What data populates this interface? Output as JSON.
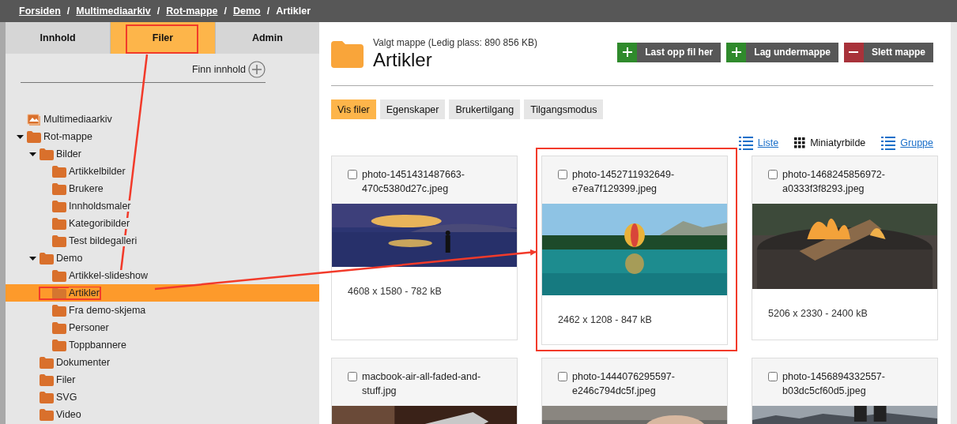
{
  "breadcrumbs": [
    {
      "label": "Forsiden",
      "kind": "link"
    },
    {
      "label": "/",
      "kind": "separator"
    },
    {
      "label": "Multimediaarkiv",
      "kind": "link"
    },
    {
      "label": "/",
      "kind": "separator"
    },
    {
      "label": "Rot-mappe",
      "kind": "link"
    },
    {
      "label": "/",
      "kind": "separator"
    },
    {
      "label": "Demo",
      "kind": "link"
    },
    {
      "label": "/",
      "kind": "separator"
    },
    {
      "label": "Artikler",
      "kind": "current"
    }
  ],
  "sidebar": {
    "tabs": [
      {
        "label": "Innhold",
        "selected": false
      },
      {
        "label": "Filer",
        "selected": true,
        "highlighted": true
      },
      {
        "label": "Admin",
        "selected": false
      }
    ],
    "find_label": "Finn innhold",
    "tree": [
      {
        "label": "Multimediaarkiv",
        "kind": "archive",
        "selected": false
      },
      {
        "label": "Rot-mappe",
        "kind": "folder",
        "selected": false,
        "expanded": true,
        "children": [
          {
            "label": "Bilder",
            "kind": "folder",
            "selected": false,
            "expanded": true,
            "children": [
              {
                "label": "Artikkelbilder",
                "kind": "folder",
                "selected": false
              },
              {
                "label": "Brukere",
                "kind": "folder",
                "selected": false
              },
              {
                "label": "Innholdsmaler",
                "kind": "folder",
                "selected": false
              },
              {
                "label": "Kategoribilder",
                "kind": "folder",
                "selected": false
              },
              {
                "label": "Test bildegalleri",
                "kind": "folder",
                "selected": false
              }
            ]
          },
          {
            "label": "Demo",
            "kind": "folder",
            "selected": false,
            "expanded": true,
            "children": [
              {
                "label": "Artikkel-slideshow",
                "kind": "folder",
                "selected": false
              },
              {
                "label": "Artikler",
                "kind": "folder",
                "selected": true,
                "highlighted": true
              },
              {
                "label": "Fra demo-skjema",
                "kind": "folder",
                "selected": false
              },
              {
                "label": "Personer",
                "kind": "folder",
                "selected": false
              },
              {
                "label": "Toppbannere",
                "kind": "folder",
                "selected": false
              }
            ]
          },
          {
            "label": "Dokumenter",
            "kind": "folder",
            "selected": false
          },
          {
            "label": "Filer",
            "kind": "folder",
            "selected": false
          },
          {
            "label": "SVG",
            "kind": "folder",
            "selected": false
          },
          {
            "label": "Video",
            "kind": "folder",
            "selected": false
          }
        ]
      }
    ]
  },
  "folder": {
    "caption": "Valgt mappe (Ledig plass: 890 856 KB)",
    "title": "Artikler",
    "actions": [
      {
        "label": "Last opp fil her",
        "kind": "add"
      },
      {
        "label": "Lag undermappe",
        "kind": "add"
      },
      {
        "label": "Slett mappe",
        "kind": "delete"
      }
    ],
    "tabs": [
      {
        "label": "Vis filer",
        "selected": true
      },
      {
        "label": "Egenskaper",
        "selected": false
      },
      {
        "label": "Brukertilgang",
        "selected": false
      },
      {
        "label": "Tilgangsmodus",
        "selected": false
      }
    ],
    "views": [
      {
        "label": "Liste",
        "kind": "list",
        "selected": false
      },
      {
        "label": "Miniatyrbilde",
        "kind": "grid",
        "selected": true
      },
      {
        "label": "Gruppe",
        "kind": "list",
        "selected": false
      }
    ]
  },
  "files": [
    {
      "name": "photo-1451431487663-470c5380d27c.jpeg",
      "checked": false,
      "meta": "4608 x 1580 - 782 kB"
    },
    {
      "name": "photo-1452711932649-e7ea7f129399.jpeg",
      "checked": false,
      "highlighted": true,
      "meta": "2462 x 1208 - 847 kB"
    },
    {
      "name": "photo-1468245856972-a0333f3f8293.jpeg",
      "checked": false,
      "meta": "5206 x 2330 - 2400 kB"
    },
    {
      "name": "macbook-air-all-faded-and-stuff.jpg",
      "checked": false
    },
    {
      "name": "photo-1444076295597-e246c794dc5f.jpeg",
      "checked": false
    },
    {
      "name": "photo-1456894332557-b03dc5cf60d5.jpeg",
      "checked": false
    }
  ]
}
